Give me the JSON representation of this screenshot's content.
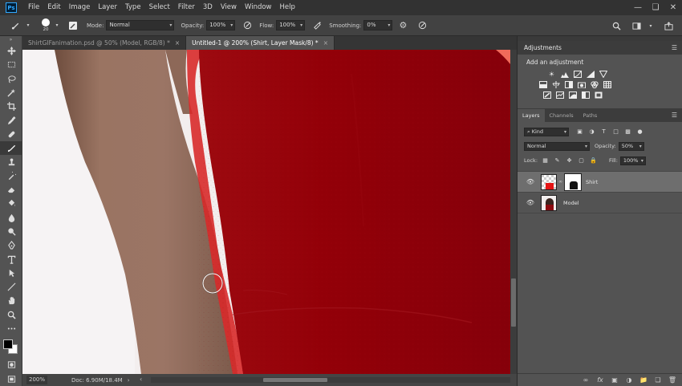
{
  "menubar": {
    "logo": "Ps",
    "items": [
      "File",
      "Edit",
      "Image",
      "Layer",
      "Type",
      "Select",
      "Filter",
      "3D",
      "View",
      "Window",
      "Help"
    ]
  },
  "options": {
    "brush_size": "20",
    "mode_label": "Mode:",
    "mode_value": "Normal",
    "opacity_label": "Opacity:",
    "opacity_value": "100%",
    "flow_label": "Flow:",
    "flow_value": "100%",
    "smoothing_label": "Smoothing:",
    "smoothing_value": "0%"
  },
  "tabs": [
    {
      "label": "ShirtGIFanimation.psd @ 50% (Model, RGB/8) *",
      "active": false
    },
    {
      "label": "Untitled-1 @ 200% (Shirt, Layer Mask/8) *",
      "active": true
    }
  ],
  "status": {
    "zoom": "200%",
    "doc": "Doc: 6.90M/18.4M"
  },
  "adjustments": {
    "title": "Adjustments",
    "subtitle": "Add an adjustment"
  },
  "layers": {
    "tabs": [
      "Layers",
      "Channels",
      "Paths"
    ],
    "filter_value": "Kind",
    "blend_mode": "Normal",
    "opacity_label": "Opacity:",
    "opacity_value": "50%",
    "lock_label": "Lock:",
    "fill_label": "Fill:",
    "fill_value": "100%",
    "items": [
      {
        "name": "Shirt",
        "selected": true
      },
      {
        "name": "Model",
        "selected": false
      }
    ]
  },
  "colors": {
    "shirt": "#8c0007",
    "skin": "#96705c",
    "accent": "#31a8ff"
  }
}
